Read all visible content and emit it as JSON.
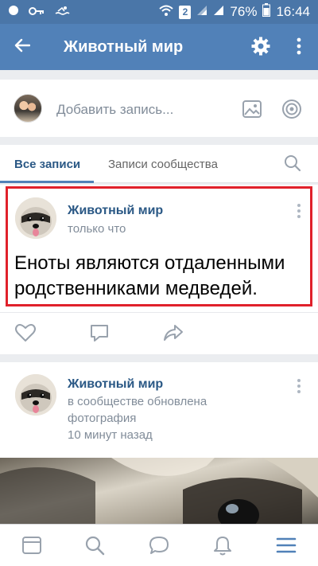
{
  "statusbar": {
    "battery": "76%",
    "time": "16:44",
    "sim_badge": "2"
  },
  "appbar": {
    "title": "Животный мир"
  },
  "composer": {
    "placeholder": "Добавить запись..."
  },
  "tabs": {
    "all": "Все записи",
    "community": "Записи сообщества"
  },
  "posts": [
    {
      "author": "Животный мир",
      "meta": "только что",
      "text": "Еноты являются отдаленными родственниками медведей."
    },
    {
      "author": "Животный мир",
      "meta_line1": "в сообществе обновлена",
      "meta_line2": "фотография",
      "meta_line3": "10 минут назад"
    }
  ],
  "colors": {
    "header": "#5181b8",
    "statusbar": "#4a76a8",
    "link": "#2a5885",
    "highlight": "#e0212b"
  },
  "icons": {
    "statusbar_left": [
      "notification-dot-icon",
      "key-icon",
      "swimmer-icon"
    ],
    "statusbar_right": [
      "wifi-icon",
      "sim-badge-icon",
      "signal-icon",
      "signal-icon",
      "battery-icon"
    ],
    "appbar": [
      "back-arrow-icon",
      "gear-icon",
      "more-vertical-icon"
    ],
    "composer": [
      "photo-icon",
      "target-icon"
    ],
    "post_actions": [
      "heart-icon",
      "comment-icon",
      "share-icon"
    ],
    "bottom_nav": [
      "news-feed-icon",
      "search-icon",
      "messages-icon",
      "notifications-icon",
      "menu-icon"
    ]
  }
}
